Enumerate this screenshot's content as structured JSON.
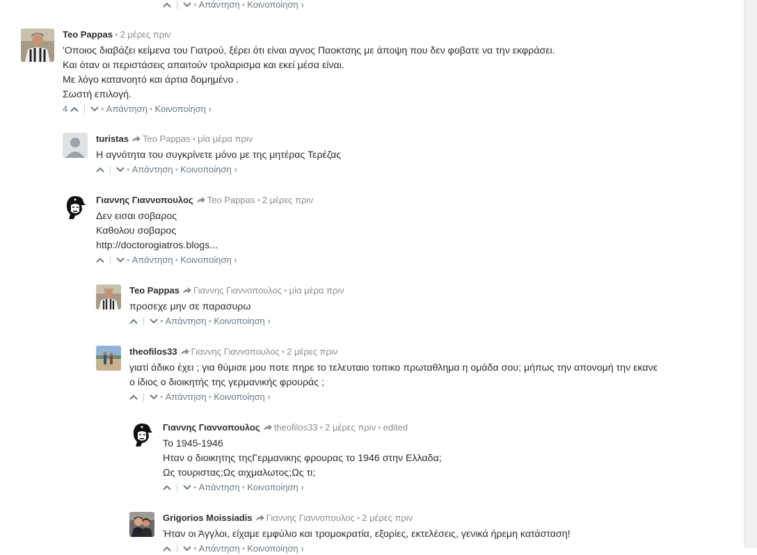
{
  "labels": {
    "reply": "Απάντηση",
    "share": "Κοινοποίηση ›"
  },
  "top_actions": {},
  "comments": [
    {
      "author": "Teo Pappas",
      "time": "2 μέρες πριν",
      "lines": [
        "'Οποιος διαβάζει κείμενα του Γιατρού, ξέρει ότι είναι αγνος Παοκτσης με άποψη που δεν φοβατε να την εκφράσει.",
        "Και όταν οι περιστάσεις απαιτούν τρολαρισμα και εκεί μέσα είναι.",
        "Με λόγο κατανοητό και άρτια δομημένο .",
        "Σωστή επιλογή."
      ],
      "votes": "4"
    },
    {
      "author": "turistas",
      "parent": "Teo Pappas",
      "time": "μία μέρα πριν",
      "lines": [
        "Η αγνότητα του συγκρίνετε μόνο με της μητέρας Τερέζας"
      ]
    },
    {
      "author": "Γιαννης Γιαννοπουλος",
      "parent": "Teo Pappas",
      "time": "2 μέρες πριν",
      "lines": [
        "Δεν εισαι σοβαρος",
        "Καθολου σοβαρος",
        "http://doctorogiatros.blogs..."
      ]
    },
    {
      "author": "Teo Pappas",
      "parent": "Γιαννης Γιαννοπουλος",
      "time": "μία μέρα πριν",
      "lines": [
        "προσεχε μην σε παρασυρω"
      ]
    },
    {
      "author": "theofilos33",
      "parent": "Γιαννης Γιαννοπουλος",
      "time": "2 μέρες πριν",
      "lines": [
        "γιατί άδικο έχει ; για θύμισε μου ποτε πηρε το τελευταιο τοπικο πρωταθλημα η ομάδα σου; μήπως την απονομή την εκανε",
        "ο ίδιος ο διοικητής της γερμανικής φρουράς ;"
      ]
    },
    {
      "author": "Γιαννης Γιαννοπουλος",
      "parent": "theofilos33",
      "time": "2 μέρες πριν",
      "edited": "edited",
      "lines": [
        "Το 1945-1946",
        "Ηταν ο διοικητης τηςΓερμανικης φρουρας το 1946 στην Ελλαδα;",
        "Ως τουριστας;Ως αιχμαλωτος;Ως τι;"
      ]
    },
    {
      "author": "Grigorios Moissiadis",
      "parent": "Γιαννης Γιαννοπουλος",
      "time": "2 μέρες πριν",
      "lines": [
        "Ήταν οι Άγγλοι, είχαμε εμφύλιο και τρομοκρατία, εξορίες, εκτελέσεις, γενικά ήρεμη κατάσταση!"
      ]
    }
  ]
}
